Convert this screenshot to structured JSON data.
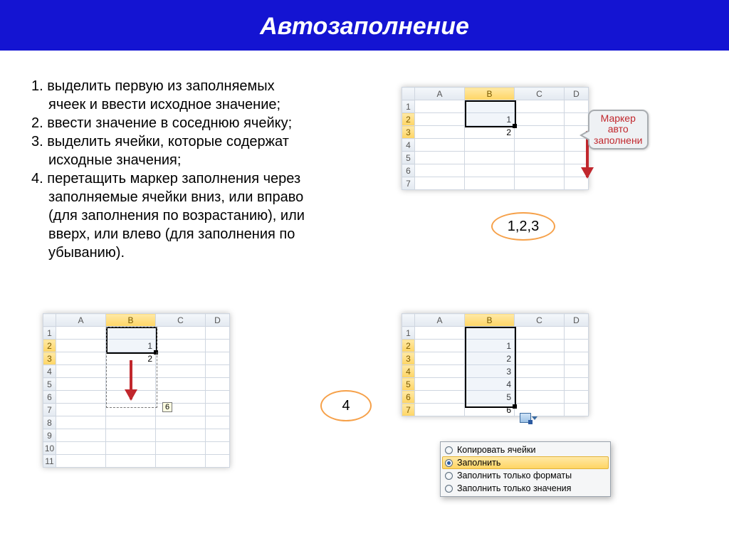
{
  "title": "Автозаполнение",
  "steps": {
    "s1": "1. выделить первую из заполняемых",
    "s1b": "ячеек и ввести исходное значение;",
    "s2": "2. ввести значение в соседнюю ячейку;",
    "s3": "3. выделить ячейки, которые содержат",
    "s3b": "исходные значения;",
    "s4": "4. перетащить маркер заполнения через",
    "s4b": "заполняемые ячейки вниз, или вправо",
    "s4c": "(для заполнения по возрастанию), или",
    "s4d": "вверх, или влево (для заполнения по",
    "s4e": "убыванию)."
  },
  "cols": {
    "A": "A",
    "B": "B",
    "C": "C",
    "D": "D"
  },
  "rows": {
    "r1": "1",
    "r2": "2",
    "r3": "3",
    "r4": "4",
    "r5": "5",
    "r6": "6",
    "r7": "7",
    "r8": "8",
    "r9": "9",
    "r10": "10",
    "r11": "11"
  },
  "sheet1": {
    "b2": "1",
    "b3": "2"
  },
  "sheet2": {
    "b2": "1",
    "b3": "2",
    "tooltip": "6"
  },
  "sheet3": {
    "b2": "1",
    "b3": "2",
    "b4": "3",
    "b5": "4",
    "b6": "5",
    "b7": "6"
  },
  "callout": {
    "l1": "Маркер",
    "l2": "авто",
    "l3": "заполнени"
  },
  "labels": {
    "oval123": "1,2,3",
    "oval4": "4"
  },
  "menu": {
    "copy": "Копировать ячейки",
    "fill": "Заполнить",
    "fmt": "Заполнить только форматы",
    "val": "Заполнить только значения"
  }
}
